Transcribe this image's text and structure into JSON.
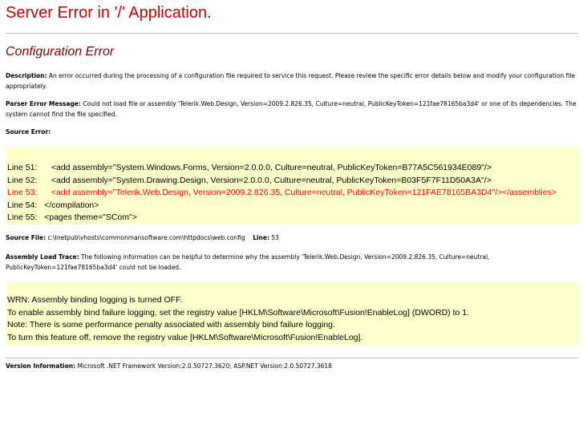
{
  "page": {
    "title": "Server Error in '/' Application.",
    "subtitle": "Configuration Error"
  },
  "description": {
    "label": "Description:",
    "text": " An error occurred during the processing of a configuration file required to service this request. Please review the specific error details below and modify your configuration file appropriately."
  },
  "parser_error": {
    "label": "Parser Error Message:",
    "text": " Could not load file or assembly 'Telerik.Web.Design, Version=2009.2.826.35, Culture=neutral, PublicKeyToken=121fae78165ba3d4' or one of its dependencies. The system cannot find the file specified."
  },
  "source_error": {
    "label": "Source Error:",
    "lines": [
      {
        "text": "Line 51:      <add assembly=\"System.Windows.Forms, Version=2.0.0.0, Culture=neutral, PublicKeyToken=B77A5C561934E089\"/>",
        "highlight": false
      },
      {
        "text": "Line 52:      <add assembly=\"System.Drawing.Design, Version=2.0.0.0, Culture=neutral, PublicKeyToken=B03F5F7F11D50A3A\"/>",
        "highlight": false
      },
      {
        "text": "Line 53:      <add assembly=\"Telerik.Web.Design, Version=2009.2.826.35, Culture=neutral, PublicKeyToken=121FAE78165BA3D4\"/></assemblies>",
        "highlight": true
      },
      {
        "text": "Line 54:   </compilation>",
        "highlight": false
      },
      {
        "text": "Line 55:   <pages theme=\"SCom\">",
        "highlight": false
      }
    ]
  },
  "source_file": {
    "label": "Source File:",
    "path": " c:\\Inetpub\\vhosts\\commonmansoftware.com\\httpdocs\\web.config",
    "line_label": "Line:",
    "line_value": " 53"
  },
  "assembly_load_trace": {
    "label": "Assembly Load Trace:",
    "text": " The following information can be helpful to determine why the assembly 'Telerik.Web.Design, Version=2009.2.826.35, Culture=neutral, PublicKeyToken=121fae78165ba3d4' could not be loaded."
  },
  "trace_box": {
    "lines": [
      "WRN: Assembly binding logging is turned OFF.",
      "To enable assembly bind failure logging, set the registry value [HKLM\\Software\\Microsoft\\Fusion!EnableLog] (DWORD) to 1.",
      "Note: There is some performance penalty associated with assembly bind failure logging.",
      "To turn this feature off, remove the registry value [HKLM\\Software\\Microsoft\\Fusion!EnableLog]."
    ]
  },
  "version_info": {
    "label": "Version Information:",
    "text": " Microsoft .NET Framework Version:2.0.50727.3620; ASP.NET Version:2.0.50727.3618"
  },
  "colors": {
    "title": "#cc0000",
    "subtitle": "#800000",
    "code_background": "#ffffcc",
    "highlight_line": "#ff0000",
    "rule": "#c0c0c0"
  }
}
